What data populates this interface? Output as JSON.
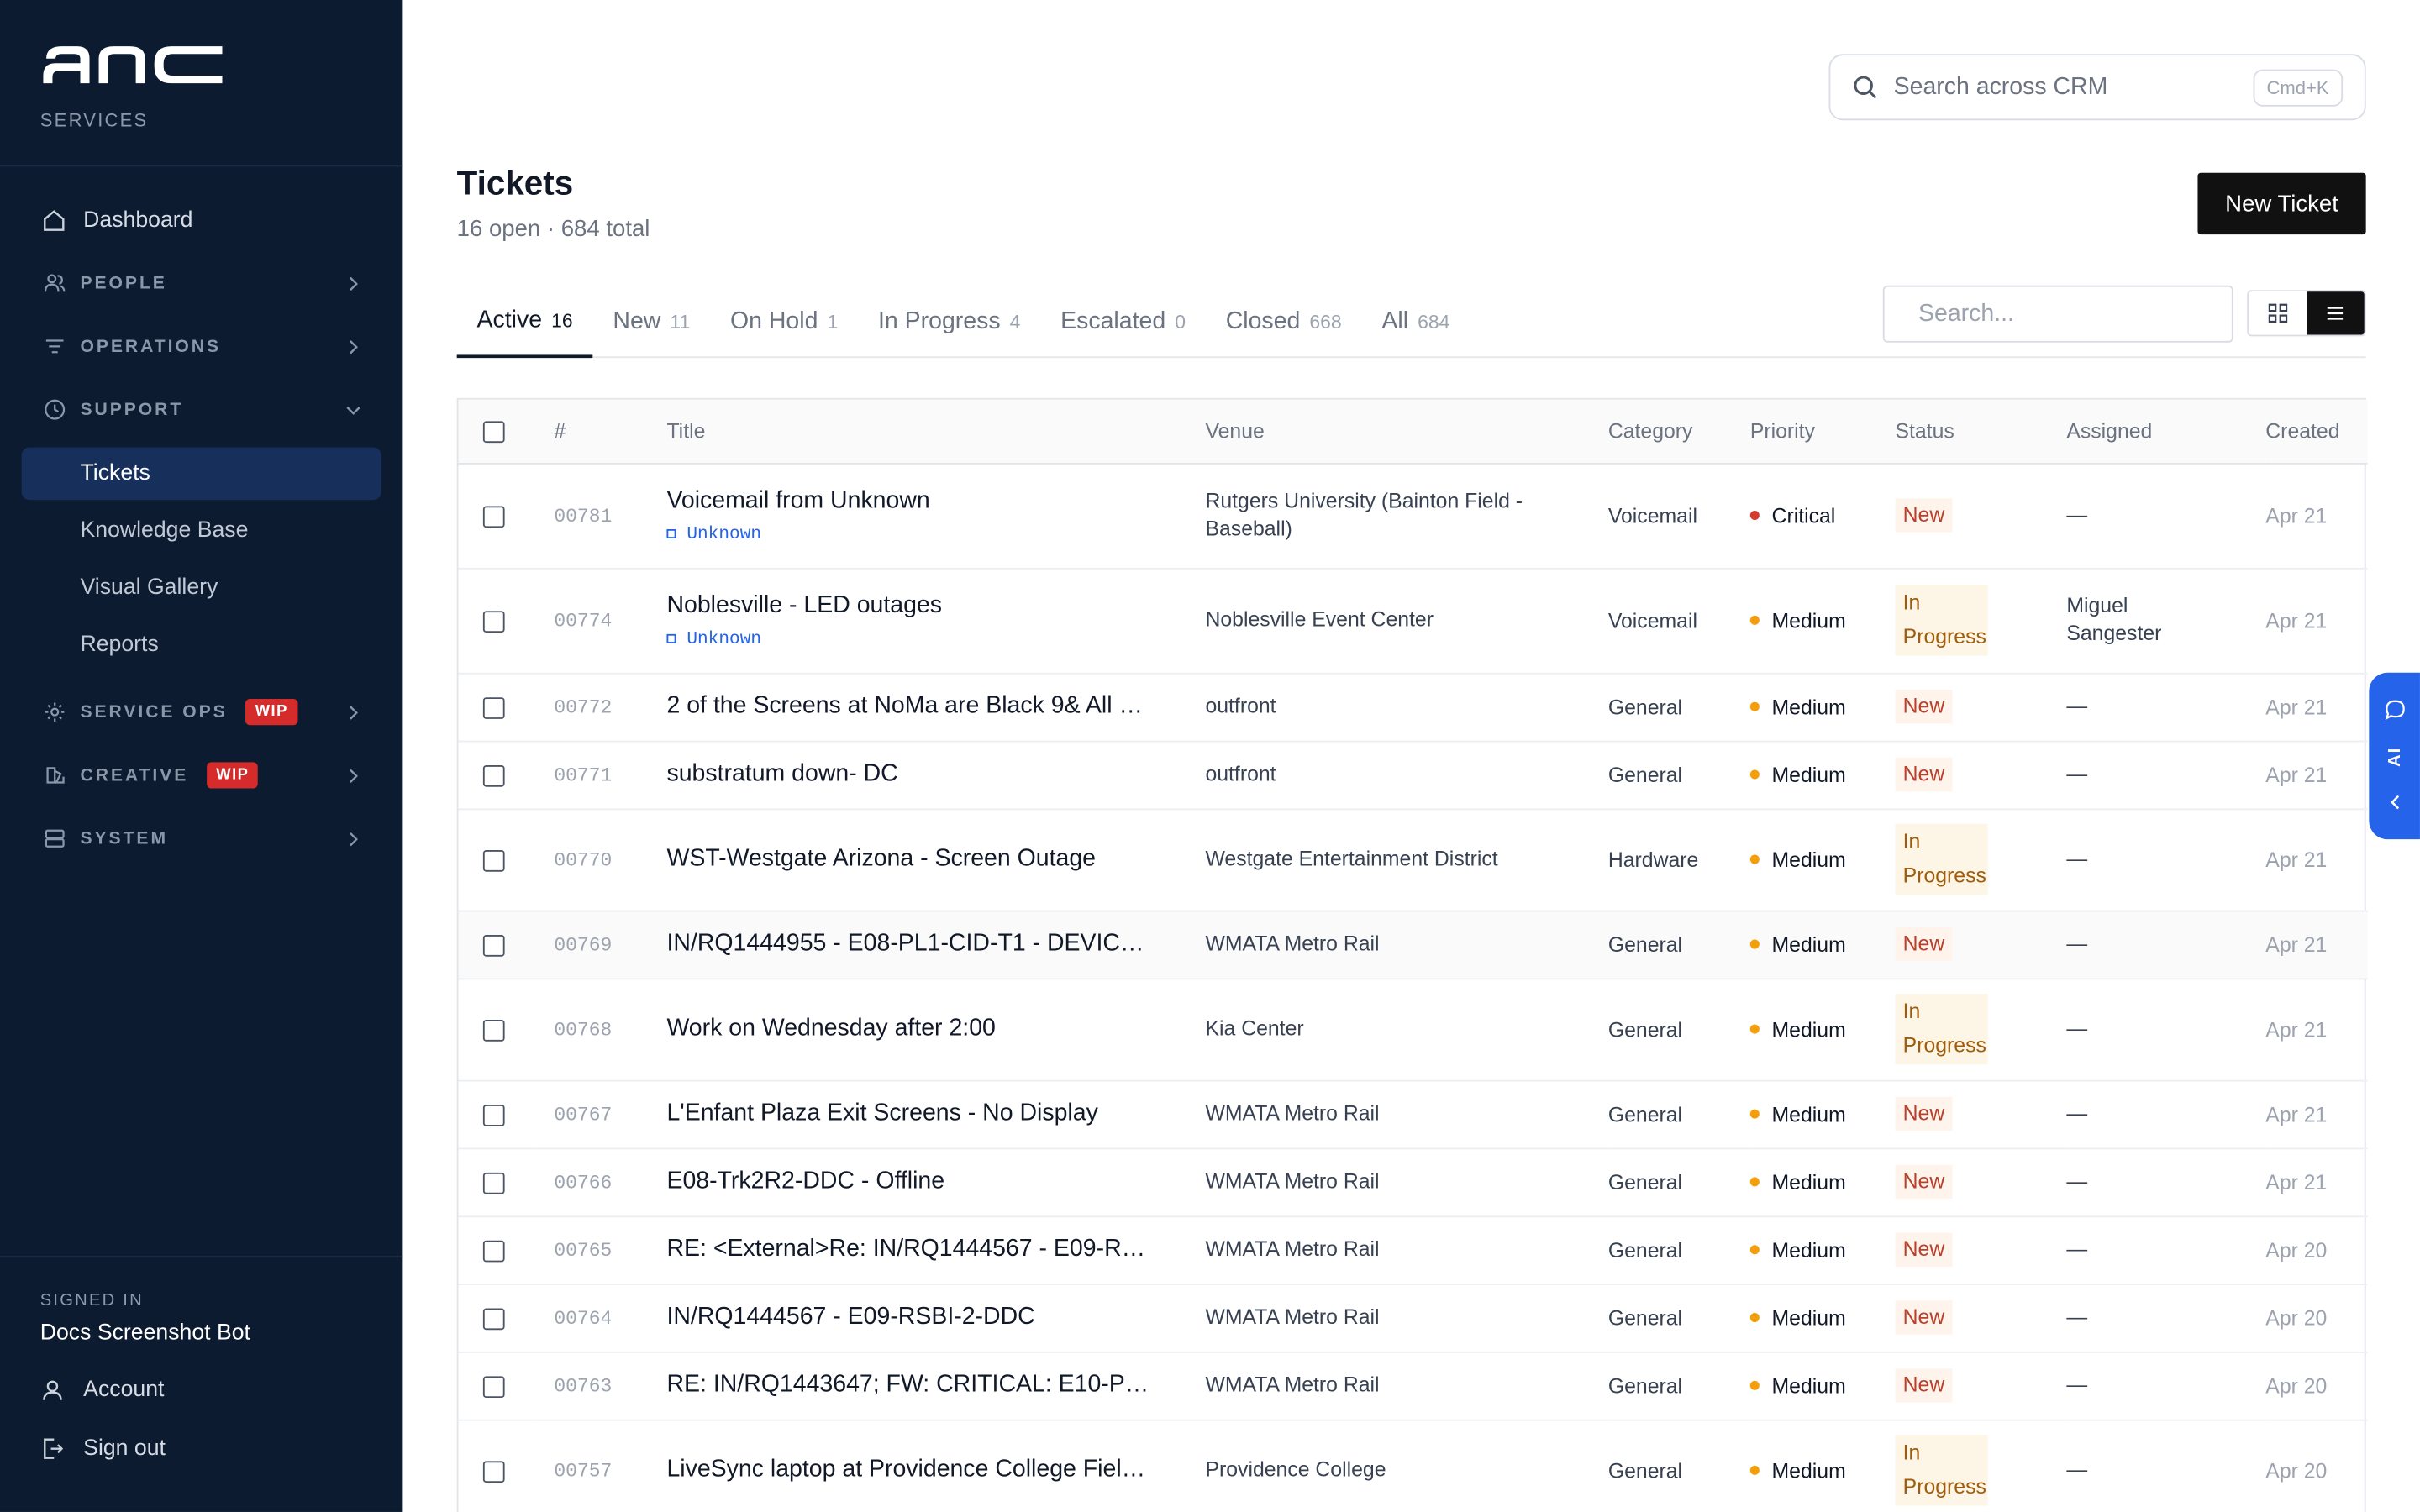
{
  "brand": {
    "logo_text": "anc",
    "subtitle": "SERVICES"
  },
  "sidebar": {
    "dashboard": "Dashboard",
    "groups": [
      {
        "label": "PEOPLE",
        "icon": "people-icon"
      },
      {
        "label": "OPERATIONS",
        "icon": "operations-icon"
      },
      {
        "label": "SUPPORT",
        "icon": "support-clock-icon"
      }
    ],
    "support_items": [
      "Tickets",
      "Knowledge Base",
      "Visual Gallery",
      "Reports"
    ],
    "active_item": "Tickets",
    "more_groups": [
      {
        "label": "SERVICE OPS",
        "badge": "WIP",
        "icon": "gear-icon"
      },
      {
        "label": "CREATIVE",
        "badge": "WIP",
        "icon": "palette-icon"
      },
      {
        "label": "SYSTEM",
        "icon": "server-icon"
      }
    ],
    "signed_in_label": "SIGNED IN",
    "signed_in_name": "Docs Screenshot Bot",
    "account": "Account",
    "sign_out": "Sign out"
  },
  "header": {
    "search_placeholder": "Search across CRM",
    "shortcut": "Cmd+K",
    "title": "Tickets",
    "subtitle": "16 open · 684 total",
    "new_button": "New Ticket"
  },
  "tabs": [
    {
      "label": "Active",
      "count": "16"
    },
    {
      "label": "New",
      "count": "11"
    },
    {
      "label": "On Hold",
      "count": "1"
    },
    {
      "label": "In Progress",
      "count": "4"
    },
    {
      "label": "Escalated",
      "count": "0"
    },
    {
      "label": "Closed",
      "count": "668"
    },
    {
      "label": "All",
      "count": "684"
    }
  ],
  "active_tab": "Active",
  "table_search_placeholder": "Search...",
  "columns": [
    "#",
    "Title",
    "Venue",
    "Category",
    "Priority",
    "Status",
    "Assigned",
    "Created"
  ],
  "rows": [
    {
      "id": "00781",
      "title": "Voicemail from Unknown",
      "tag": "Unknown",
      "venue": "Rutgers University (Bainton Field - Baseball)",
      "category": "Voicemail",
      "priority": "Critical",
      "status": "New",
      "assigned": "—",
      "created": "Apr 21"
    },
    {
      "id": "00774",
      "title": "Noblesville - LED outages",
      "tag": "Unknown",
      "venue": "Noblesville Event Center",
      "category": "Voicemail",
      "priority": "Medium",
      "status": "In Progress",
      "assigned": "Miguel Sangester",
      "created": "Apr 21"
    },
    {
      "id": "00772",
      "title": "2 of the Screens at NoMa are Black 9& All 3…",
      "tag": "",
      "venue": "outfront",
      "category": "General",
      "priority": "Medium",
      "status": "New",
      "assigned": "—",
      "created": "Apr 21"
    },
    {
      "id": "00771",
      "title": "substratum down- DC",
      "tag": "",
      "venue": "outfront",
      "category": "General",
      "priority": "Medium",
      "status": "New",
      "assigned": "—",
      "created": "Apr 21"
    },
    {
      "id": "00770",
      "title": "WST-Westgate Arizona - Screen Outage",
      "tag": "",
      "venue": "Westgate Entertainment District",
      "category": "Hardware",
      "priority": "Medium",
      "status": "In Progress",
      "assigned": "—",
      "created": "Apr 21"
    },
    {
      "id": "00769",
      "title": "IN/RQ1444955 - E08-PL1-CID-T1 - DEVIC…",
      "tag": "",
      "venue": "WMATA Metro Rail",
      "category": "General",
      "priority": "Medium",
      "status": "New",
      "assigned": "—",
      "created": "Apr 21"
    },
    {
      "id": "00768",
      "title": "Work on Wednesday after 2:00",
      "tag": "",
      "venue": "Kia Center",
      "category": "General",
      "priority": "Medium",
      "status": "In Progress",
      "assigned": "—",
      "created": "Apr 21"
    },
    {
      "id": "00767",
      "title": "L'Enfant Plaza Exit Screens - No Display",
      "tag": "",
      "venue": "WMATA Metro Rail",
      "category": "General",
      "priority": "Medium",
      "status": "New",
      "assigned": "—",
      "created": "Apr 21"
    },
    {
      "id": "00766",
      "title": "E08-Trk2R2-DDC - Offline",
      "tag": "",
      "venue": "WMATA Metro Rail",
      "category": "General",
      "priority": "Medium",
      "status": "New",
      "assigned": "—",
      "created": "Apr 21"
    },
    {
      "id": "00765",
      "title": "RE: <External>Re: IN/RQ1444567 - E09-R…",
      "tag": "",
      "venue": "WMATA Metro Rail",
      "category": "General",
      "priority": "Medium",
      "status": "New",
      "assigned": "—",
      "created": "Apr 20"
    },
    {
      "id": "00764",
      "title": "IN/RQ1444567 - E09-RSBI-2-DDC",
      "tag": "",
      "venue": "WMATA Metro Rail",
      "category": "General",
      "priority": "Medium",
      "status": "New",
      "assigned": "—",
      "created": "Apr 20"
    },
    {
      "id": "00763",
      "title": "RE: IN/RQ1443647; FW: CRITICAL: E10-P…",
      "tag": "",
      "venue": "WMATA Metro Rail",
      "category": "General",
      "priority": "Medium",
      "status": "New",
      "assigned": "—",
      "created": "Apr 20"
    },
    {
      "id": "00757",
      "title": "LiveSync laptop at Providence College Field…",
      "tag": "",
      "venue": "Providence College",
      "category": "General",
      "priority": "Medium",
      "status": "In Progress",
      "assigned": "—",
      "created": "Apr 20"
    }
  ],
  "ai_tab": {
    "label": "AI"
  },
  "colors": {
    "sidebar_bg": "#0c1b30",
    "active_nav": "#16305b",
    "critical": "#d33b2c",
    "medium": "#f59e0b",
    "accent": "#2563eb"
  }
}
